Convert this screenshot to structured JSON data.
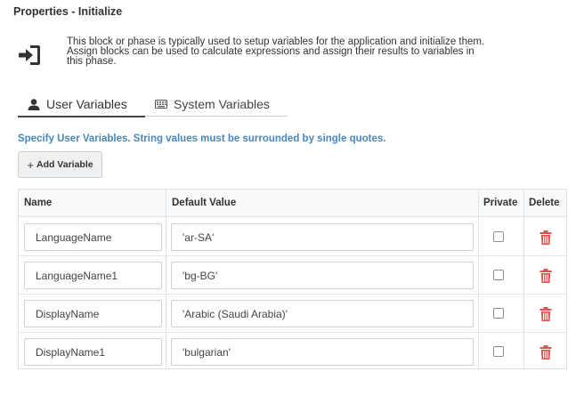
{
  "header": {
    "title": "Properties - Initialize"
  },
  "intro": {
    "icon": "sign-in-icon",
    "lines": [
      "This block or phase is typically used to setup variables for the application and initialize them.",
      "Assign blocks can be used to calculate expressions and assign their results to variables in",
      "this phase."
    ]
  },
  "tabs": [
    {
      "label": "User Variables",
      "icon": "user-icon",
      "active": true
    },
    {
      "label": "System Variables",
      "icon": "keyboard-icon",
      "active": false
    }
  ],
  "hint": "Specify User Variables. String values must be surrounded by single quotes.",
  "add_button": {
    "plus": "+",
    "label": "Add Variable"
  },
  "table": {
    "headers": {
      "name": "Name",
      "default_value": "Default Value",
      "private": "Private",
      "delete": "Delete"
    },
    "rows": [
      {
        "name": "LanguageName",
        "value": "'ar-SA'",
        "private": false
      },
      {
        "name": "LanguageName1",
        "value": "'bg-BG'",
        "private": false
      },
      {
        "name": "DisplayName",
        "value": "'Arabic (Saudi Arabia)'",
        "private": false
      },
      {
        "name": "DisplayName1",
        "value": "'bulgarian'",
        "private": false
      }
    ]
  },
  "colors": {
    "accent": "#4a86b8",
    "delete": "#d9534f",
    "text": "#333333"
  }
}
